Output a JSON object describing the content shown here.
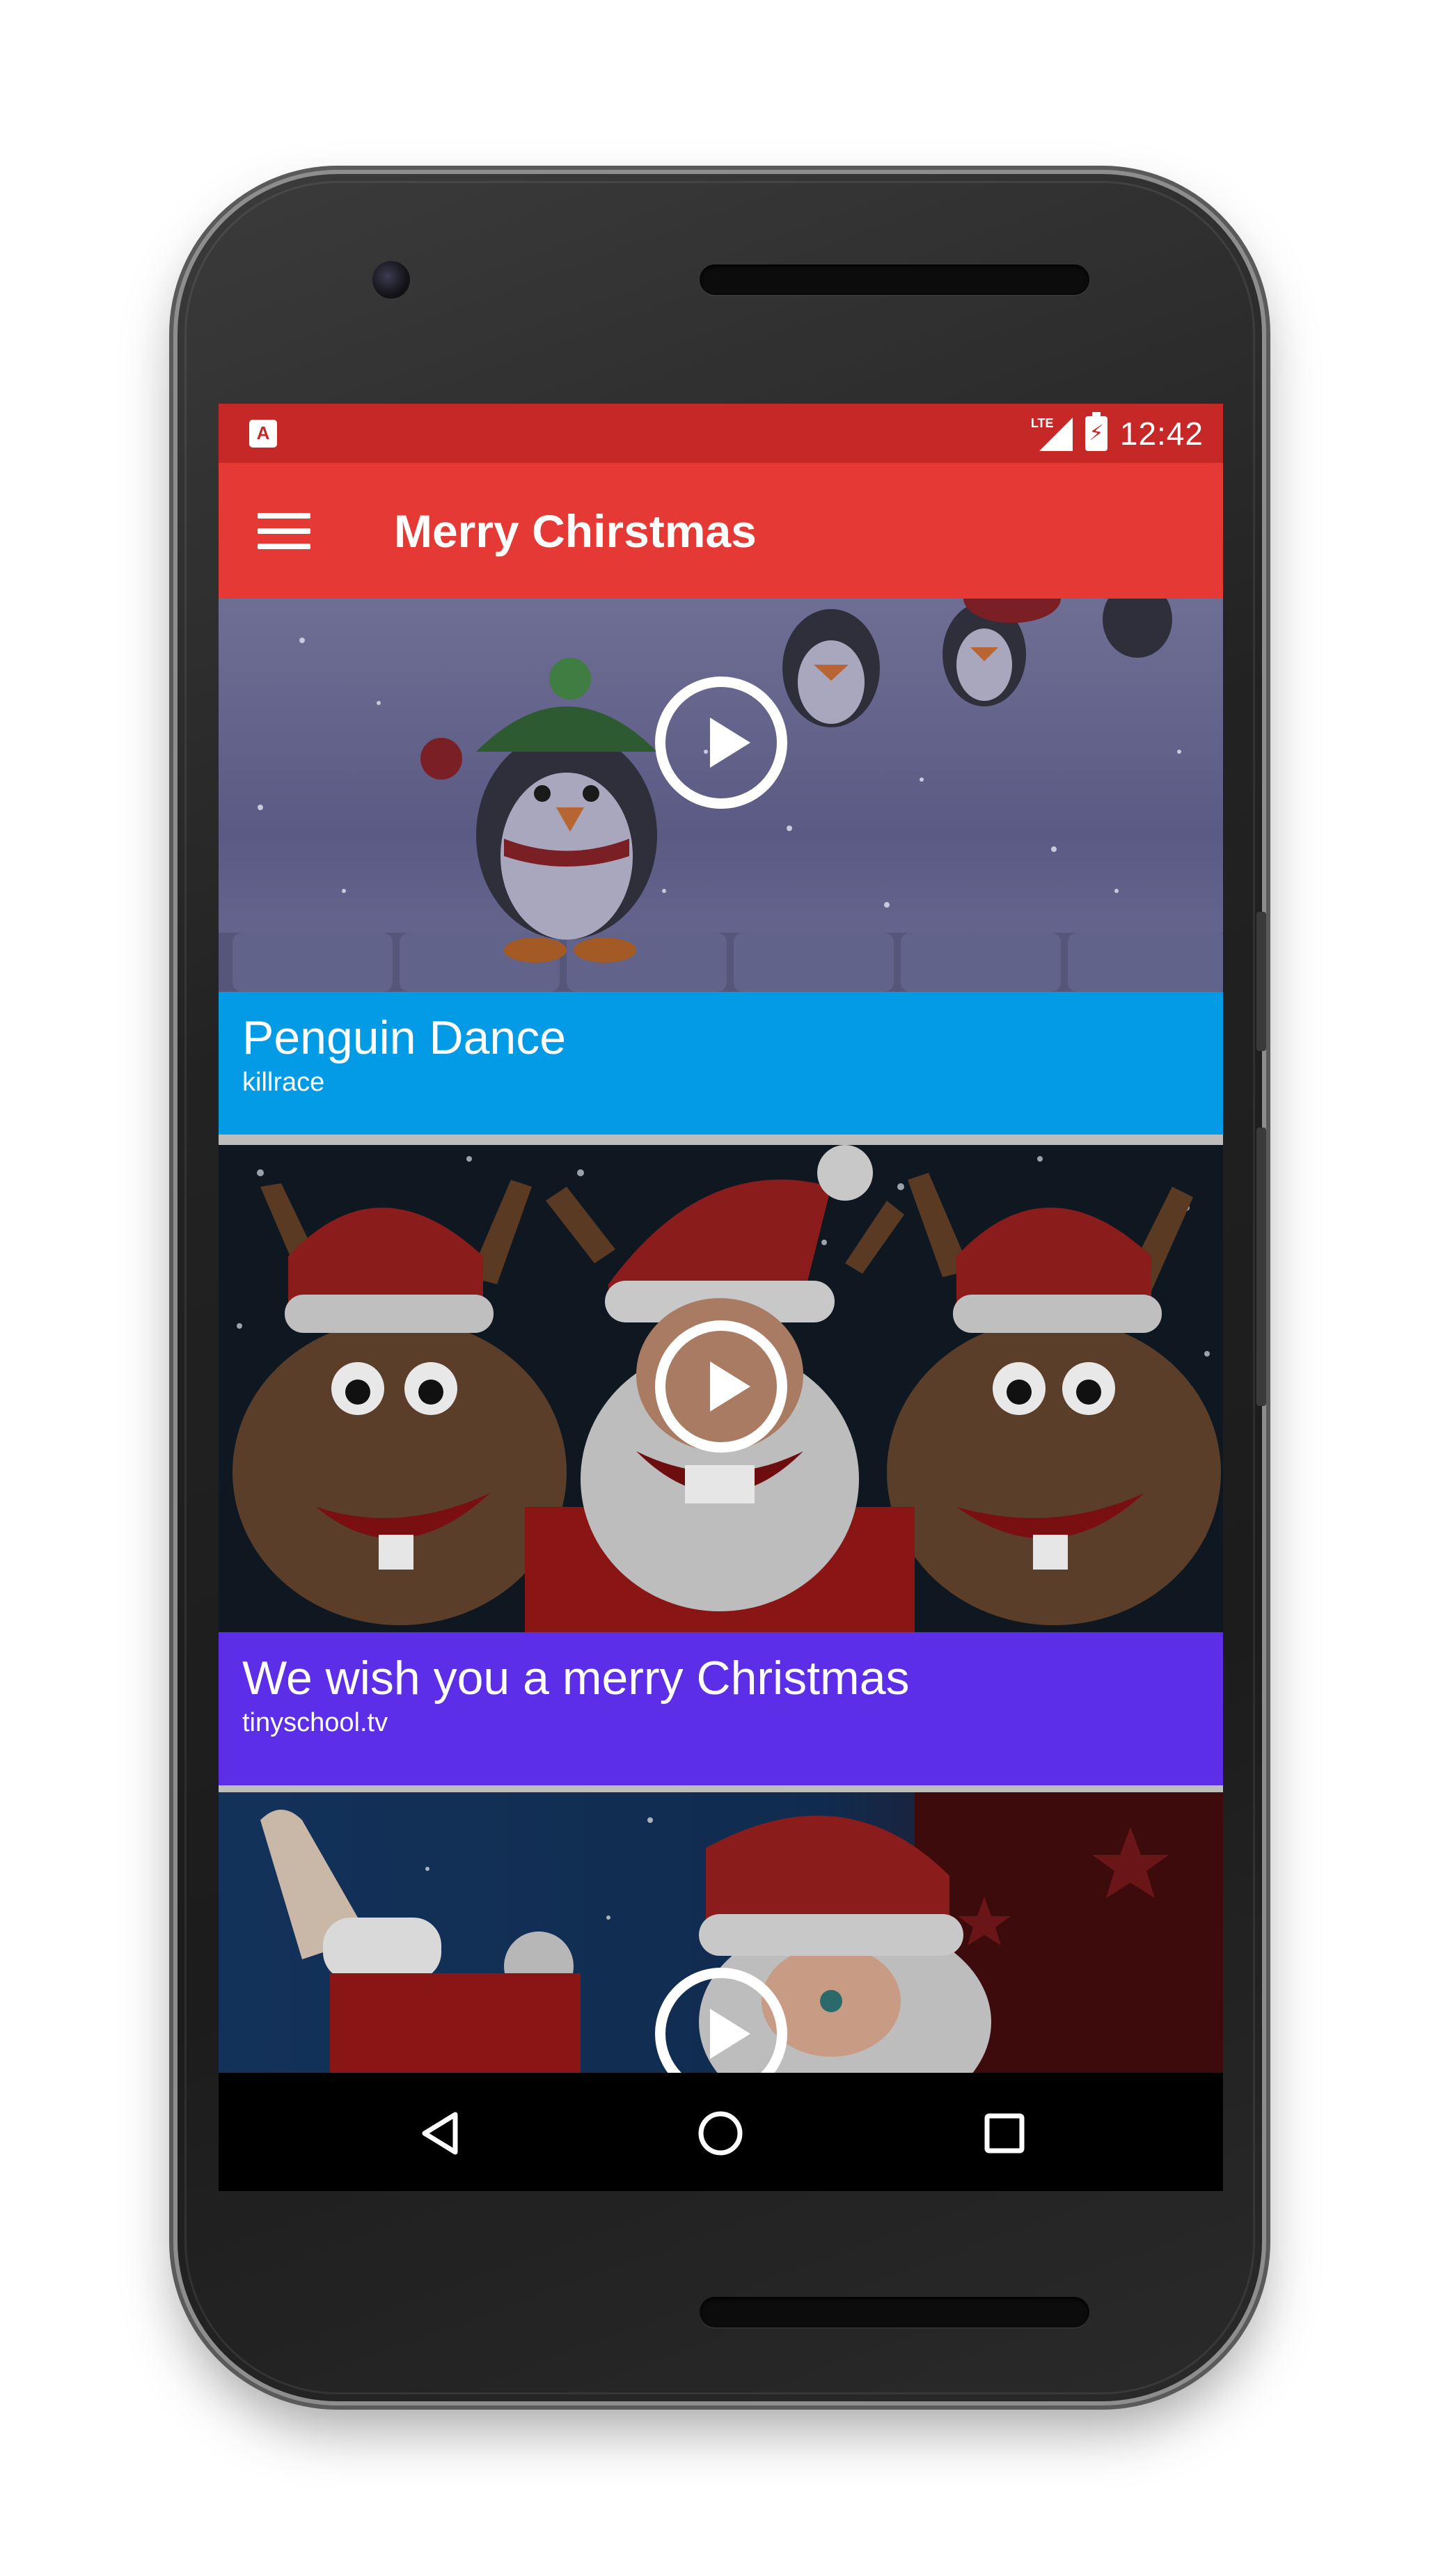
{
  "status_bar": {
    "notification_icon": "app-notification-icon",
    "notification_glyph": "A",
    "network_label": "LTE",
    "time": "12:42",
    "color": "#c62828"
  },
  "app_bar": {
    "title": "Merry Chirstmas",
    "menu_icon": "hamburger-menu-icon",
    "color": "#e53935"
  },
  "videos": [
    {
      "title": "Penguin Dance",
      "channel": "killrace",
      "caption_color": "#039be5",
      "thumbnail": "penguins-in-snow"
    },
    {
      "title": "We wish you a merry Christmas",
      "channel": "tinyschool.tv",
      "caption_color": "#5c2ee8",
      "thumbnail": "reindeer-and-santa"
    },
    {
      "title": "",
      "channel": "",
      "caption_color": "#7a0c0c",
      "thumbnail": "waving-santa-night-sky"
    }
  ],
  "nav_bar": {
    "back_icon": "back-triangle-icon",
    "home_icon": "home-circle-icon",
    "recents_icon": "recents-square-icon"
  }
}
